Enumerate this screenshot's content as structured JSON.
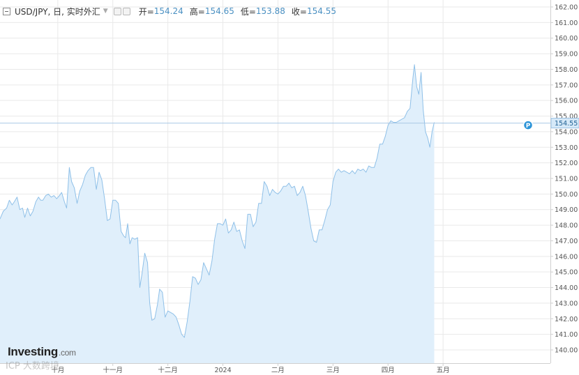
{
  "header": {
    "title": "USD/JPY, 日, 实时外汇",
    "open_label": "开=",
    "open": "154.24",
    "high_label": "高=",
    "high": "154.65",
    "low_label": "低=",
    "low": "153.88",
    "close_label": "收=",
    "close": "154.55"
  },
  "logo": {
    "main": "Investing",
    "suffix": ".com"
  },
  "watermark": "ICP 大数跨境",
  "colors": {
    "line": "#8fc0e8",
    "fill": "#e0effb",
    "grid": "#e9e9e9",
    "axis": "#cfcfcf",
    "marker": "#2c94d8"
  },
  "chart_data": {
    "type": "area",
    "title": "USD/JPY, 日, 实时外汇",
    "ylim": [
      139.5,
      162.3
    ],
    "y_ticks": [
      "140.00",
      "141.00",
      "142.00",
      "143.00",
      "144.00",
      "145.00",
      "146.00",
      "147.00",
      "148.00",
      "149.00",
      "150.00",
      "151.00",
      "152.00",
      "153.00",
      "154.00",
      "155.00",
      "156.00",
      "157.00",
      "158.00",
      "159.00",
      "160.00",
      "161.00",
      "162.00"
    ],
    "x_ticks": [
      {
        "label": "十月",
        "x": 0.105
      },
      {
        "label": "十一月",
        "x": 0.205
      },
      {
        "label": "十二月",
        "x": 0.305
      },
      {
        "label": "2024",
        "x": 0.405
      },
      {
        "label": "二月",
        "x": 0.505
      },
      {
        "label": "三月",
        "x": 0.605
      },
      {
        "label": "四月",
        "x": 0.705
      },
      {
        "label": "五月",
        "x": 0.805
      }
    ],
    "last_price": "154.55",
    "last_value": 154.55,
    "marker_label": "P",
    "grid": true,
    "series": [
      {
        "values": [
          [
            0.0,
            148.4
          ],
          [
            0.006,
            148.9
          ],
          [
            0.012,
            149.1
          ],
          [
            0.017,
            149.6
          ],
          [
            0.022,
            149.3
          ],
          [
            0.026,
            149.5
          ],
          [
            0.031,
            149.8
          ],
          [
            0.036,
            149.0
          ],
          [
            0.041,
            149.1
          ],
          [
            0.045,
            148.5
          ],
          [
            0.05,
            149.1
          ],
          [
            0.055,
            148.6
          ],
          [
            0.06,
            148.9
          ],
          [
            0.065,
            149.5
          ],
          [
            0.07,
            149.8
          ],
          [
            0.074,
            149.6
          ],
          [
            0.078,
            149.6
          ],
          [
            0.083,
            149.9
          ],
          [
            0.088,
            150.0
          ],
          [
            0.093,
            149.8
          ],
          [
            0.098,
            149.9
          ],
          [
            0.103,
            149.7
          ],
          [
            0.108,
            149.9
          ],
          [
            0.112,
            150.1
          ],
          [
            0.117,
            149.5
          ],
          [
            0.121,
            149.1
          ],
          [
            0.126,
            151.7
          ],
          [
            0.13,
            150.8
          ],
          [
            0.135,
            150.4
          ],
          [
            0.14,
            149.4
          ],
          [
            0.145,
            150.2
          ],
          [
            0.15,
            150.6
          ],
          [
            0.155,
            151.2
          ],
          [
            0.16,
            151.5
          ],
          [
            0.165,
            151.7
          ],
          [
            0.17,
            151.7
          ],
          [
            0.175,
            150.3
          ],
          [
            0.18,
            151.4
          ],
          [
            0.185,
            150.9
          ],
          [
            0.19,
            149.7
          ],
          [
            0.195,
            148.3
          ],
          [
            0.2,
            148.4
          ],
          [
            0.205,
            149.6
          ],
          [
            0.21,
            149.6
          ],
          [
            0.215,
            149.4
          ],
          [
            0.22,
            147.6
          ],
          [
            0.225,
            147.3
          ],
          [
            0.228,
            147.2
          ],
          [
            0.232,
            148.1
          ],
          [
            0.236,
            146.8
          ],
          [
            0.24,
            147.2
          ],
          [
            0.245,
            147.1
          ],
          [
            0.25,
            147.2
          ],
          [
            0.254,
            144.0
          ],
          [
            0.258,
            144.9
          ],
          [
            0.263,
            146.2
          ],
          [
            0.268,
            145.6
          ],
          [
            0.272,
            143.0
          ],
          [
            0.276,
            141.9
          ],
          [
            0.281,
            142.0
          ],
          [
            0.286,
            142.9
          ],
          [
            0.29,
            143.9
          ],
          [
            0.295,
            143.7
          ],
          [
            0.3,
            142.1
          ],
          [
            0.305,
            142.5
          ],
          [
            0.31,
            142.4
          ],
          [
            0.315,
            142.3
          ],
          [
            0.32,
            142.1
          ],
          [
            0.325,
            141.6
          ],
          [
            0.33,
            141.0
          ],
          [
            0.335,
            140.8
          ],
          [
            0.34,
            141.8
          ],
          [
            0.345,
            143.1
          ],
          [
            0.35,
            144.7
          ],
          [
            0.355,
            144.6
          ],
          [
            0.36,
            144.2
          ],
          [
            0.365,
            144.5
          ],
          [
            0.37,
            145.6
          ],
          [
            0.375,
            145.2
          ],
          [
            0.38,
            144.8
          ],
          [
            0.385,
            145.7
          ],
          [
            0.39,
            147.1
          ],
          [
            0.395,
            148.1
          ],
          [
            0.4,
            148.1
          ],
          [
            0.405,
            148.0
          ],
          [
            0.41,
            148.4
          ],
          [
            0.415,
            147.5
          ],
          [
            0.42,
            147.7
          ],
          [
            0.425,
            148.2
          ],
          [
            0.43,
            147.6
          ],
          [
            0.435,
            147.7
          ],
          [
            0.44,
            147.0
          ],
          [
            0.445,
            146.5
          ],
          [
            0.45,
            148.7
          ],
          [
            0.455,
            148.7
          ],
          [
            0.46,
            147.9
          ],
          [
            0.465,
            148.2
          ],
          [
            0.47,
            149.4
          ],
          [
            0.475,
            149.4
          ],
          [
            0.48,
            150.8
          ],
          [
            0.485,
            150.5
          ],
          [
            0.49,
            149.9
          ],
          [
            0.495,
            150.3
          ],
          [
            0.5,
            150.1
          ],
          [
            0.505,
            150.0
          ],
          [
            0.51,
            150.2
          ],
          [
            0.515,
            150.5
          ],
          [
            0.52,
            150.5
          ],
          [
            0.525,
            150.7
          ],
          [
            0.53,
            150.4
          ],
          [
            0.535,
            150.5
          ],
          [
            0.54,
            149.9
          ],
          [
            0.545,
            150.1
          ],
          [
            0.55,
            150.5
          ],
          [
            0.555,
            149.9
          ],
          [
            0.56,
            148.9
          ],
          [
            0.565,
            147.8
          ],
          [
            0.57,
            147.0
          ],
          [
            0.575,
            146.9
          ],
          [
            0.58,
            147.7
          ],
          [
            0.585,
            147.7
          ],
          [
            0.59,
            148.3
          ],
          [
            0.595,
            149.0
          ],
          [
            0.6,
            149.3
          ],
          [
            0.605,
            150.8
          ],
          [
            0.61,
            151.4
          ],
          [
            0.615,
            151.6
          ],
          [
            0.62,
            151.4
          ],
          [
            0.625,
            151.5
          ],
          [
            0.63,
            151.4
          ],
          [
            0.635,
            151.3
          ],
          [
            0.64,
            151.5
          ],
          [
            0.645,
            151.3
          ],
          [
            0.65,
            151.6
          ],
          [
            0.655,
            151.5
          ],
          [
            0.66,
            151.6
          ],
          [
            0.665,
            151.4
          ],
          [
            0.67,
            151.8
          ],
          [
            0.675,
            151.7
          ],
          [
            0.68,
            151.7
          ],
          [
            0.685,
            152.3
          ],
          [
            0.69,
            153.2
          ],
          [
            0.695,
            153.2
          ],
          [
            0.7,
            153.7
          ],
          [
            0.705,
            154.4
          ],
          [
            0.71,
            154.7
          ],
          [
            0.715,
            154.6
          ],
          [
            0.72,
            154.6
          ],
          [
            0.725,
            154.7
          ],
          [
            0.73,
            154.8
          ],
          [
            0.735,
            154.9
          ],
          [
            0.74,
            155.3
          ],
          [
            0.745,
            155.5
          ],
          [
            0.75,
            157.4
          ],
          [
            0.753,
            158.3
          ],
          [
            0.757,
            156.9
          ],
          [
            0.761,
            156.4
          ],
          [
            0.765,
            157.8
          ],
          [
            0.769,
            155.4
          ],
          [
            0.773,
            154.0
          ],
          [
            0.777,
            153.6
          ],
          [
            0.781,
            153.0
          ],
          [
            0.785,
            154.0
          ],
          [
            0.789,
            154.6
          ]
        ]
      }
    ]
  }
}
